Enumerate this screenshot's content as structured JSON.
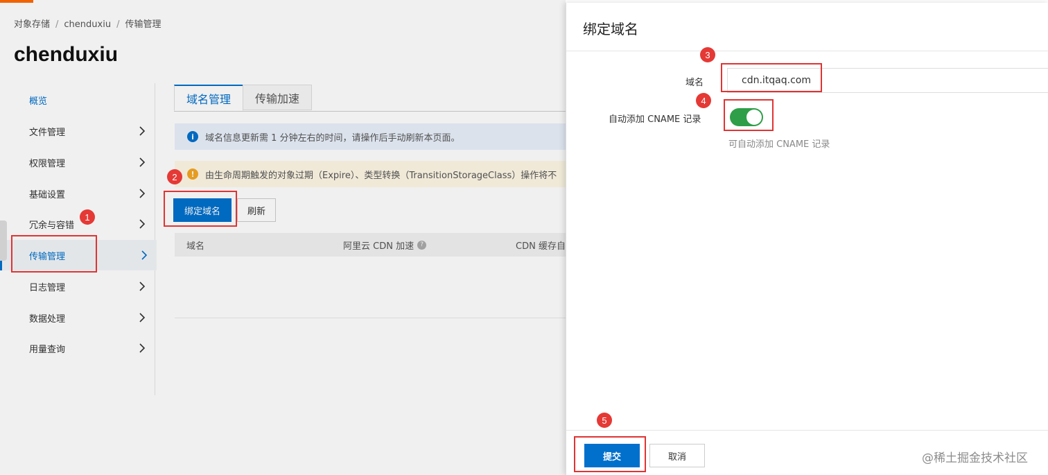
{
  "breadcrumb": [
    "对象存储",
    "chenduxiu",
    "传输管理"
  ],
  "bucket_name": "chenduxiu",
  "sidebar": {
    "items": [
      {
        "label": "概览"
      },
      {
        "label": "文件管理"
      },
      {
        "label": "权限管理"
      },
      {
        "label": "基础设置"
      },
      {
        "label": "冗余与容错"
      },
      {
        "label": "传输管理"
      },
      {
        "label": "日志管理"
      },
      {
        "label": "数据处理"
      },
      {
        "label": "用量查询"
      }
    ],
    "active": "传输管理"
  },
  "tabs": [
    {
      "label": "域名管理",
      "active": true
    },
    {
      "label": "传输加速",
      "active": false
    }
  ],
  "notices": {
    "info": "域名信息更新需 1 分钟左右的时间，请操作后手动刷新本页面。",
    "warning": "由生命周期触发的对象过期（Expire）、类型转换（TransitionStorageClass）操作将不"
  },
  "toolbar": {
    "bind_domain": "绑定域名",
    "refresh": "刷新"
  },
  "table": {
    "columns": [
      "域名",
      "阿里云 CDN 加速",
      "CDN 缓存自"
    ]
  },
  "drawer": {
    "title": "绑定域名",
    "domain_label": "域名",
    "domain_value": "cdn.itqaq.com",
    "cname_label": "自动添加 CNAME 记录",
    "cname_enabled": true,
    "cname_help": "可自动添加 CNAME 记录",
    "submit": "提交",
    "cancel": "取消"
  },
  "annotations": [
    "1",
    "2",
    "3",
    "4",
    "5"
  ],
  "watermark": "@稀土掘金技术社区",
  "colors": {
    "primary": "#0070cc",
    "toggle_on": "#2e9e48",
    "highlight": "#e03333",
    "accent": "#ff6a00"
  }
}
